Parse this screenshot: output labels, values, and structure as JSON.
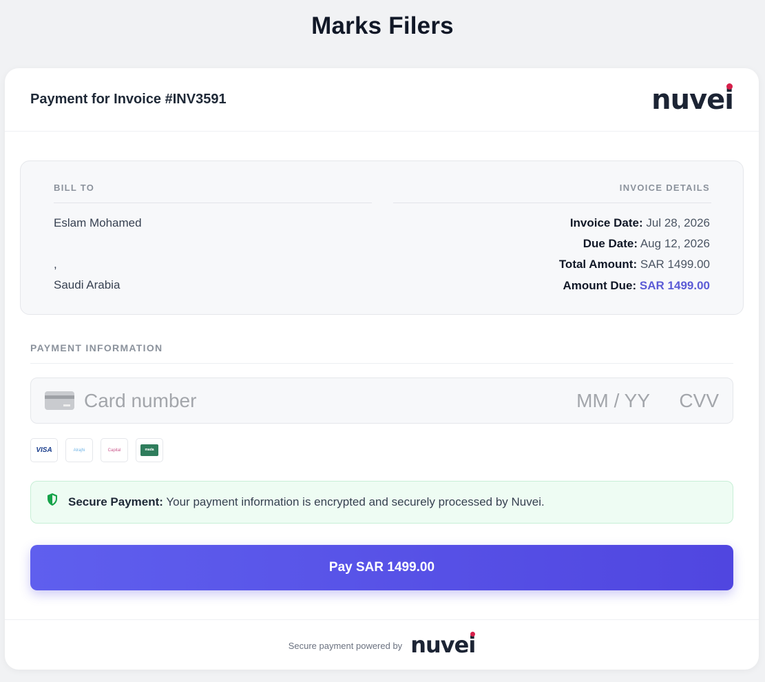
{
  "page": {
    "title": "Marks Filers"
  },
  "header": {
    "title": "Payment for Invoice #INV3591",
    "logo_text": "nuvei"
  },
  "bill_to": {
    "label": "BILL TO",
    "name": "Eslam Mohamed",
    "address_line": ",",
    "country": "Saudi Arabia"
  },
  "invoice_details": {
    "label": "INVOICE DETAILS",
    "invoice_date_label": "Invoice Date:",
    "invoice_date": "Jul 28, 2026",
    "due_date_label": "Due Date:",
    "due_date": "Aug 12, 2026",
    "total_amount_label": "Total Amount:",
    "total_amount": "SAR 1499.00",
    "amount_due_label": "Amount Due:",
    "amount_due": "SAR 1499.00"
  },
  "payment_info": {
    "label": "PAYMENT INFORMATION",
    "card_number_placeholder": "Card number",
    "expiry_placeholder": "MM / YY",
    "cvv_placeholder": "CVV",
    "card_brands": [
      {
        "name": "visa-brand-icon",
        "text": "VISA"
      },
      {
        "name": "card-brand-2-icon",
        "text": "Alrajhi"
      },
      {
        "name": "card-brand-3-icon",
        "text": "Capital"
      },
      {
        "name": "card-brand-4-icon",
        "text": "mada"
      }
    ]
  },
  "secure_notice": {
    "title": "Secure Payment:",
    "text": " Your payment information is encrypted and securely processed by Nuvei."
  },
  "pay_button": {
    "label": "Pay SAR 1499.00"
  },
  "footer": {
    "text": "Secure payment powered by",
    "logo_text": "nuvei"
  },
  "colors": {
    "accent": "#5b5bd6",
    "button_start": "#5f5fee",
    "button_end": "#5046e0",
    "secure_bg": "#eefcf3",
    "logo_dot": "#d61f4a"
  }
}
